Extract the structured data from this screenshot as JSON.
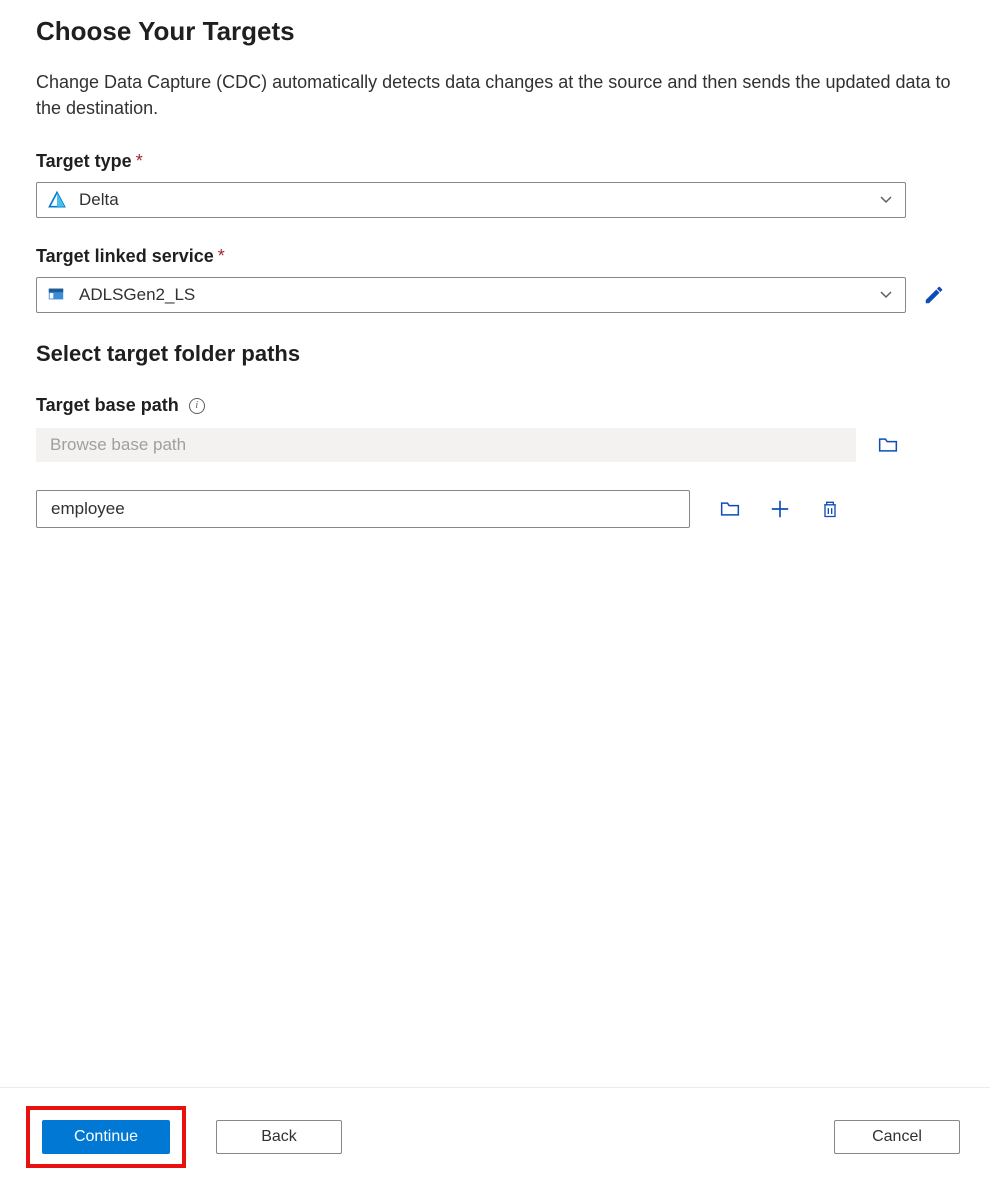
{
  "page": {
    "title": "Choose Your Targets",
    "description": "Change Data Capture (CDC) automatically detects data changes at the source and then sends the updated data to the destination."
  },
  "target_type": {
    "label": "Target type",
    "value": "Delta"
  },
  "linked_service": {
    "label": "Target linked service",
    "value": "ADLSGen2_LS"
  },
  "paths_section": {
    "heading": "Select target folder paths",
    "base_path_label": "Target base path",
    "base_path_placeholder": "Browse base path",
    "path_value": "employee"
  },
  "footer": {
    "continue_label": "Continue",
    "back_label": "Back",
    "cancel_label": "Cancel"
  }
}
